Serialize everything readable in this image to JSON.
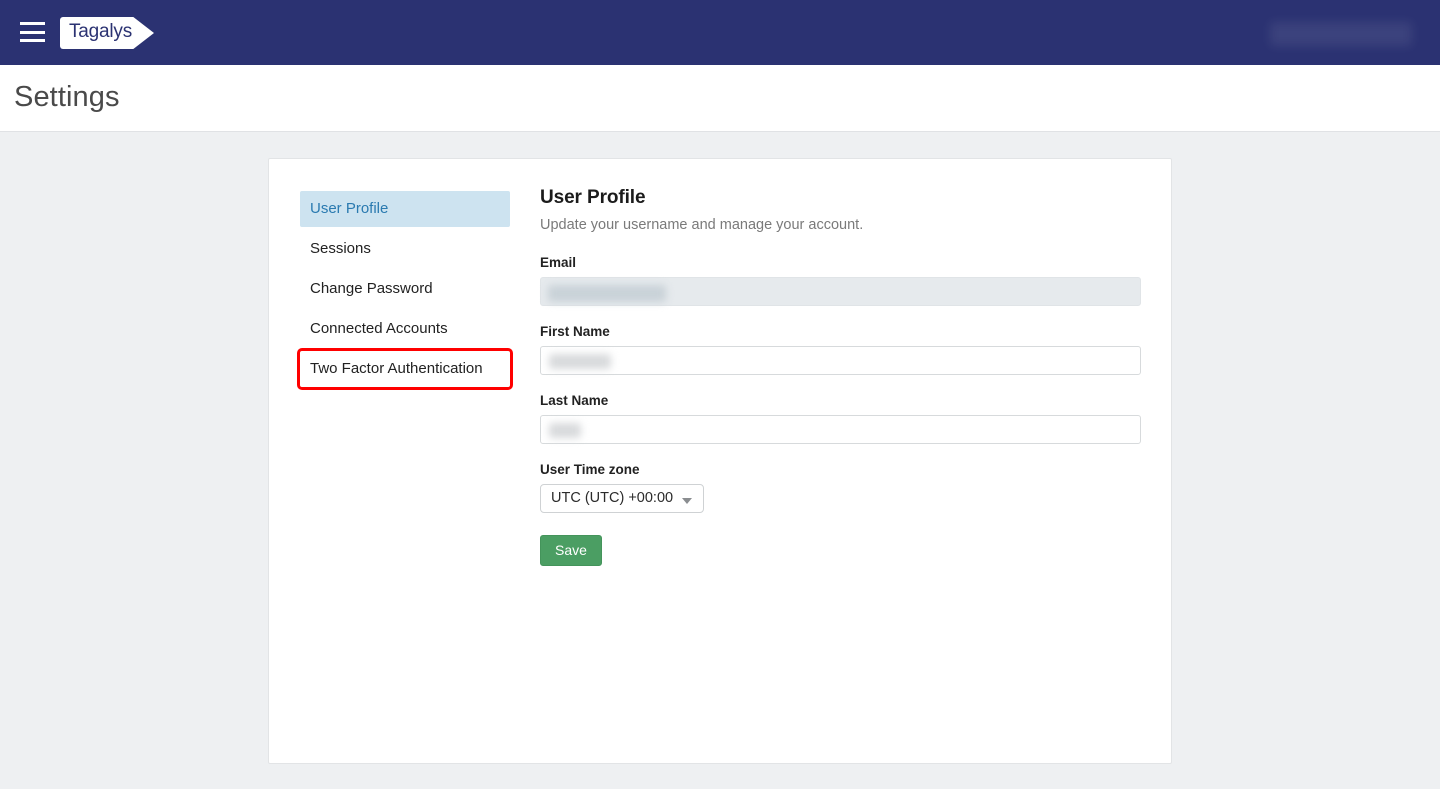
{
  "topbar": {
    "menu_icon": "hamburger-menu-icon",
    "logo_text": "Tagalys",
    "account_label": ""
  },
  "page": {
    "title": "Settings"
  },
  "settings_nav": {
    "items": [
      {
        "label": "User Profile",
        "active": true,
        "highlighted": false
      },
      {
        "label": "Sessions",
        "active": false,
        "highlighted": false
      },
      {
        "label": "Change Password",
        "active": false,
        "highlighted": false
      },
      {
        "label": "Connected Accounts",
        "active": false,
        "highlighted": false
      },
      {
        "label": "Two Factor Authentication",
        "active": false,
        "highlighted": true
      }
    ]
  },
  "user_profile": {
    "heading": "User Profile",
    "description": "Update your username and manage your account.",
    "fields": {
      "email": {
        "label": "Email",
        "value": "",
        "placeholder": "",
        "disabled": true
      },
      "first_name": {
        "label": "First Name",
        "value": "",
        "placeholder": ""
      },
      "last_name": {
        "label": "Last Name",
        "value": "",
        "placeholder": ""
      },
      "timezone": {
        "label": "User Time zone",
        "value": "UTC (UTC) +00:00"
      }
    },
    "save_label": "Save"
  },
  "colors": {
    "header_navy": "#2b3272",
    "page_background": "#eef0f2",
    "active_nav_background": "#cde3f0",
    "active_nav_text": "#2a7ab0",
    "highlight_red": "#ff0000",
    "save_green": "#4b9e63",
    "disabled_input": "#e6eaed"
  }
}
